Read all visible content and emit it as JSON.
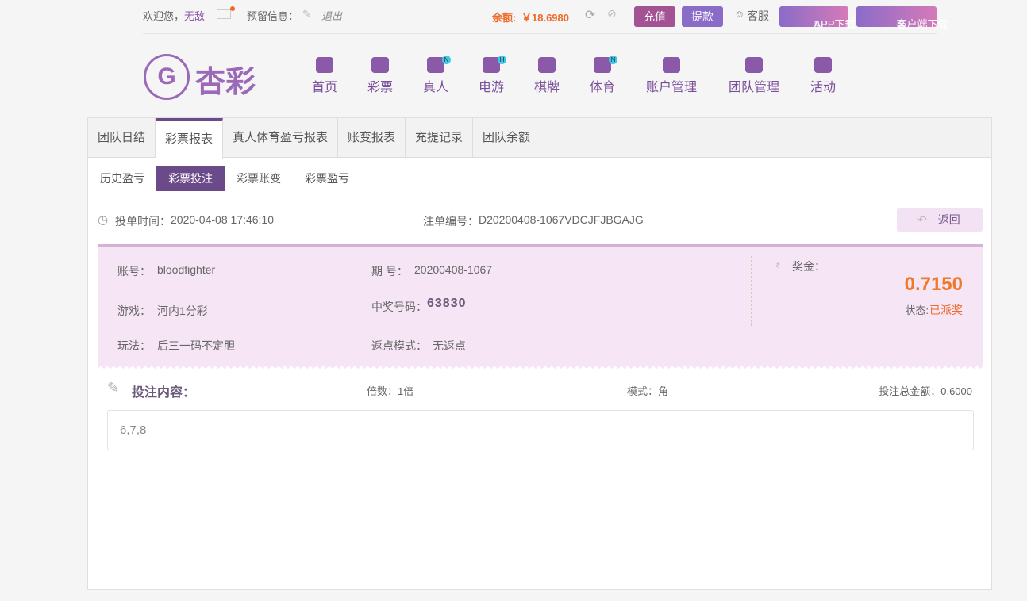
{
  "topbar": {
    "welcome": "欢迎您，",
    "username": "无敌",
    "reserved_info": "预留信息：",
    "logout": "退出",
    "balance_label": "余额:",
    "balance": "￥18.6980",
    "deposit": "充值",
    "withdraw": "提款",
    "service": "客服",
    "app_download": "APP下载",
    "client_download": "客户端下载"
  },
  "logo": "杏彩",
  "nav": [
    {
      "label": "首页"
    },
    {
      "label": "彩票"
    },
    {
      "label": "真人",
      "badge": "N"
    },
    {
      "label": "电游",
      "badge": "H"
    },
    {
      "label": "棋牌"
    },
    {
      "label": "体育",
      "badge": "N"
    },
    {
      "label": "账户管理"
    },
    {
      "label": "团队管理"
    },
    {
      "label": "活动"
    }
  ],
  "tabs": [
    "团队日结",
    "彩票报表",
    "真人体育盈亏报表",
    "账变报表",
    "充提记录",
    "团队余额"
  ],
  "subtabs": [
    "历史盈亏",
    "彩票投注",
    "彩票账变",
    "彩票盈亏"
  ],
  "order": {
    "time_label": "投单时间：",
    "time": "2020-04-08 17:46:10",
    "id_label": "注单编号：",
    "id": "D20200408-1067VDCJFJBGAJG",
    "back": "返回"
  },
  "detail": {
    "account_label": "账号：",
    "account": "bloodfighter",
    "issue_label": "期 号：",
    "issue": "20200408-1067",
    "game_label": "游戏：",
    "game": "河内1分彩",
    "win_label": "中奖号码：",
    "win_number": "63830",
    "play_label": "玩法：",
    "play": "后三一码不定胆",
    "rebate_label": "返点模式：",
    "rebate": "无返点",
    "prize_label": "奖金：",
    "prize": "0.7150",
    "status_label": "状态:",
    "status": "已派奖"
  },
  "bet": {
    "title": "投注内容：",
    "multiple": "倍数：1倍",
    "mode": "模式：角",
    "total": "投注总金额：0.6000",
    "content": "6,7,8"
  },
  "colors": {
    "accent": "#6b4a8a",
    "orange": "#f07a2a"
  }
}
